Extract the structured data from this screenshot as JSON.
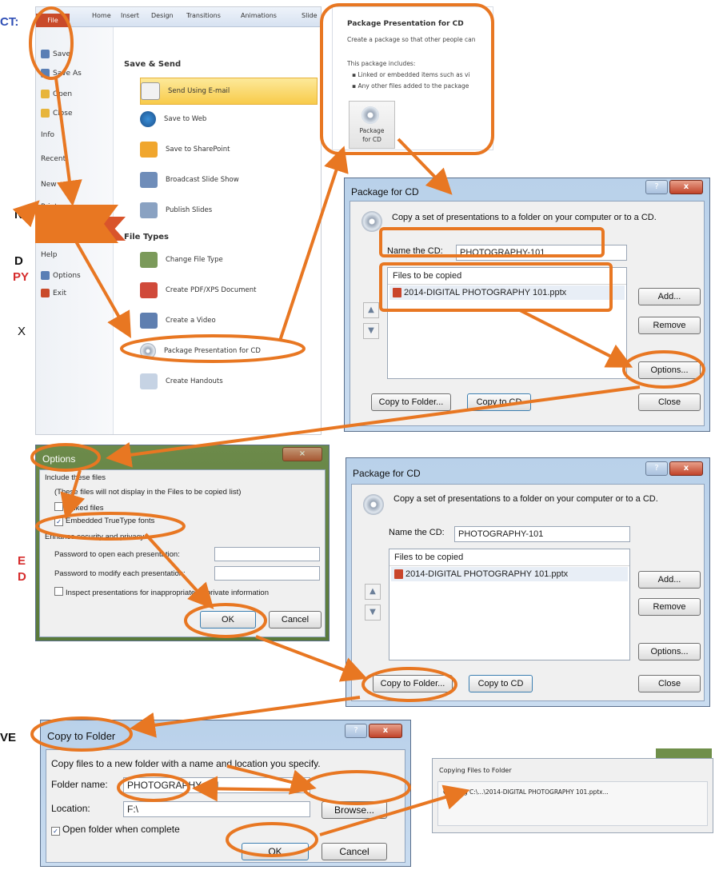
{
  "left_fragments": [
    {
      "text": "CT:",
      "color": "#2f4fb5"
    },
    {
      "text": "N",
      "color": "#111111"
    },
    {
      "text": "D",
      "color": "#111111"
    },
    {
      "text": "PY",
      "color": "#d62c2c"
    },
    {
      "text": "X",
      "color": "#111111"
    },
    {
      "text": "E",
      "color": "#d62c2c"
    },
    {
      "text": "D",
      "color": "#d62c2c"
    },
    {
      "text": "VE",
      "color": "#111111"
    }
  ],
  "backstage": {
    "tabs": [
      "File",
      "Home",
      "Insert",
      "Design",
      "Transitions",
      "Animations",
      "Slide"
    ],
    "left_items": [
      "Save",
      "Save As",
      "Open",
      "Close",
      "Info",
      "Recent",
      "New",
      "Print",
      "Save & Send",
      "Help",
      "Options",
      "Exit"
    ],
    "save_send_header": "Save & Send",
    "save_send_items": [
      "Send Using E-mail",
      "Save to Web",
      "Save to SharePoint",
      "Broadcast Slide Show",
      "Publish Slides"
    ],
    "file_types_header": "File Types",
    "file_type_items": [
      "Change File Type",
      "Create PDF/XPS Document",
      "Create a Video",
      "Package Presentation for CD",
      "Create Handouts"
    ]
  },
  "package_panel": {
    "title": "Package Presentation for CD",
    "desc": "Create a package so that other people can",
    "includes_label": "This package includes:",
    "bullets": [
      "Linked or embedded items such as vi",
      "Any other files added to the package"
    ],
    "button_line1": "Package",
    "button_line2": "for CD"
  },
  "package_dialog": {
    "title": "Package for CD",
    "help": "?",
    "close_x": "x",
    "description": "Copy a set of presentations to a folder on your computer or to a CD.",
    "name_label": "Name the CD:",
    "name_value": "PHOTOGRAPHY-101",
    "files_header": "Files to be copied",
    "file_name": "2014-DIGITAL PHOTOGRAPHY 101.pptx",
    "add": "Add...",
    "remove": "Remove",
    "options": "Options...",
    "copy_folder": "Copy to Folder...",
    "copy_cd": "Copy to CD",
    "close": "Close"
  },
  "options_dialog": {
    "title": "Options",
    "include_label": "Include these files",
    "note": "(These files will not display in the Files to be copied list)",
    "linked": "Linked files",
    "embedded": "Embedded TrueType fonts",
    "security_label": "Enhance security and privacy",
    "pwd_open": "Password to open each presentation:",
    "pwd_modify": "Password to modify each presentation:",
    "inspect": "Inspect presentations for inappropriate or private information",
    "ok": "OK",
    "cancel": "Cancel"
  },
  "copy_folder_dialog": {
    "title": "Copy to Folder",
    "help": "?",
    "close_x": "x",
    "description": "Copy files to a new folder with a name and location you specify.",
    "folder_label": "Folder name:",
    "folder_value": "PHOTOGRAPHY-101",
    "location_label": "Location:",
    "location_value": "F:\\",
    "browse": "Browse...",
    "open_when_complete": "Open folder when complete",
    "ok": "OK",
    "cancel": "Cancel"
  },
  "progress_window": {
    "title": "Copying Files to Folder",
    "message": "Copying C:\\...\\2014-DIGITAL PHOTOGRAPHY 101.pptx..."
  },
  "accent_color": "#e87722"
}
